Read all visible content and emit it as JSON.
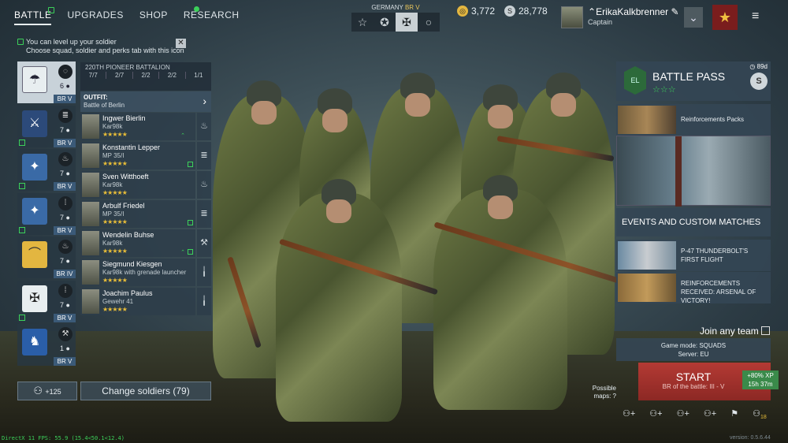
{
  "nav": {
    "tabs": [
      "BATTLE",
      "UPGRADES",
      "SHOP",
      "RESEARCH"
    ]
  },
  "tip": {
    "line1": "You can level up your soldier",
    "line2": "Choose squad, soldier and perks tab with this icon"
  },
  "nation": {
    "name": "GERMANY",
    "br": "BR V",
    "icons": [
      "☆",
      "✪",
      "✠",
      "○"
    ]
  },
  "currency": {
    "silver": "3,772",
    "gold": "28,778"
  },
  "profile": {
    "name": "ErikaKalkbrenner",
    "rank": "Captain"
  },
  "squads": [
    {
      "icon": "parachute-icon",
      "glyph": "☂",
      "count": "6",
      "br": "BR V"
    },
    {
      "icon": "rifles-icon",
      "glyph": "⚔",
      "count": "7",
      "br": "BR V"
    },
    {
      "icon": "flame-icon",
      "glyph": "✦",
      "count": "7",
      "br": "BR V"
    },
    {
      "icon": "eagle-icon",
      "glyph": "✦",
      "count": "7",
      "br": "BR V"
    },
    {
      "icon": "bow-icon",
      "glyph": "⌒",
      "count": "7",
      "br": "BR IV"
    },
    {
      "icon": "cross-icon",
      "glyph": "✠",
      "count": "7",
      "br": "BR V"
    },
    {
      "icon": "lion-icon",
      "glyph": "♞",
      "count": "1",
      "br": "BR V"
    }
  ],
  "squad": {
    "name": "220TH PIONEER BATTALION",
    "stats": [
      "7/7",
      "2/7",
      "2/2",
      "2/2",
      "1/1"
    ]
  },
  "outfit": {
    "label": "OUTFIT:",
    "value": "Battle of Berlin"
  },
  "soldiers": [
    {
      "name": "Ingwer Bierlin",
      "weapon": "Kar98k",
      "stars": "★★★★★"
    },
    {
      "name": "Konstantin Lepper",
      "weapon": "MP 35/I",
      "stars": "★★★★★"
    },
    {
      "name": "Sven Witthoeft",
      "weapon": "Kar98k",
      "stars": "★★★★★"
    },
    {
      "name": "Arbulf Friedel",
      "weapon": "MP 35/I",
      "stars": "★★★★★"
    },
    {
      "name": "Wendelin Buhse",
      "weapon": "Kar98k",
      "stars": "★★★★★"
    },
    {
      "name": "Siegmund Kiesgen",
      "weapon": "Kar98k with grenade launcher",
      "stars": "★★★★★"
    },
    {
      "name": "Joachim Paulus",
      "weapon": "Gewehr 41",
      "stars": "★★★★★"
    }
  ],
  "buttons": {
    "add_squads": "+125",
    "change_soldiers": "Change soldiers (79)"
  },
  "battlepass": {
    "title": "BATTLE PASS",
    "stars": "☆☆☆",
    "days": "89d",
    "currency": "S"
  },
  "reinforcements": {
    "label": "Reinforcements Packs"
  },
  "events": {
    "header": "EVENTS AND CUSTOM MATCHES",
    "items": [
      "P-47 THUNDERBOLT'S FIRST FLIGHT",
      "REINFORCEMENTS RECEIVED: ARSENAL OF VICTORY!"
    ]
  },
  "join": {
    "label": "Join any team"
  },
  "mode": {
    "line1": "Game mode: SQUADS",
    "line2": "Server: EU"
  },
  "start": {
    "label": "START",
    "br": "BR of the battle: III - V"
  },
  "xp": {
    "bonus": "+80% XP",
    "time": "15h 37m"
  },
  "maps": {
    "label": "Possible maps:"
  },
  "party": {
    "count": "18"
  },
  "footer": {
    "fps": "DirectX 11 FPS: 55.9 (15.4<50.1<12.4)",
    "version": "version: 0.5.6.44"
  }
}
